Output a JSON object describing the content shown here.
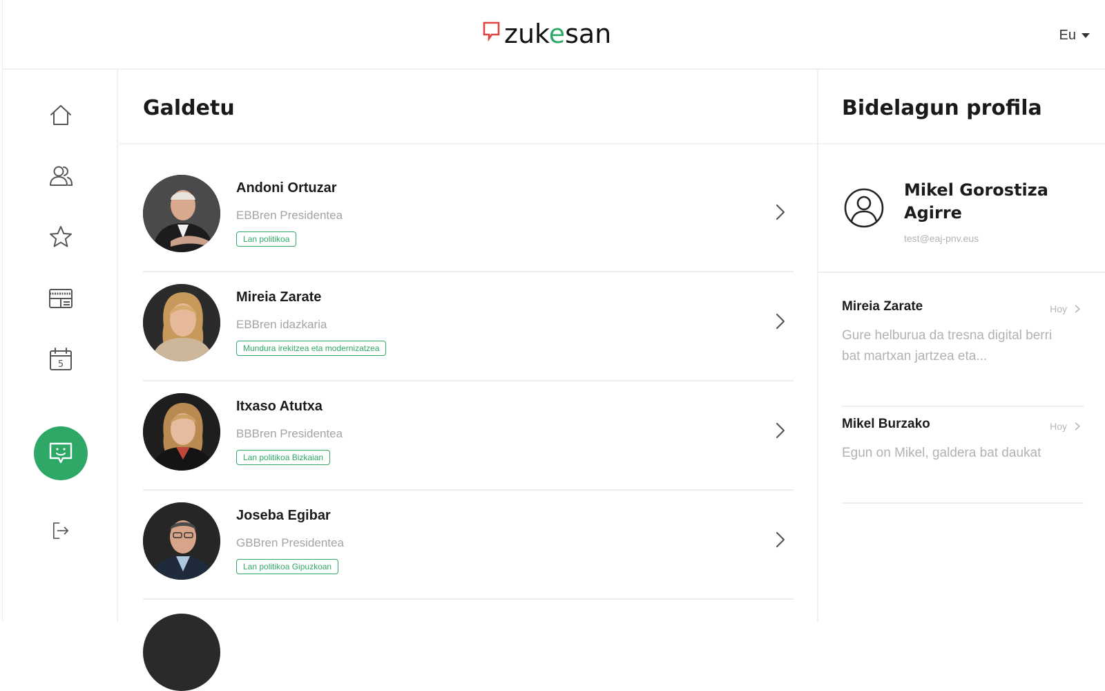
{
  "header": {
    "logo_text_a": "zuk",
    "logo_text_b": "e",
    "logo_text_c": "san",
    "language": "Eu"
  },
  "colors": {
    "accent": "#2ea866",
    "logo_mark": "#e0443f"
  },
  "sidebar": {
    "items": [
      {
        "icon": "home-icon"
      },
      {
        "icon": "users-icon"
      },
      {
        "icon": "star-icon"
      },
      {
        "icon": "news-icon"
      },
      {
        "icon": "calendar-icon"
      },
      {
        "icon": "chat-icon",
        "active": true
      },
      {
        "icon": "logout-icon"
      }
    ]
  },
  "main": {
    "title": "Galdetu",
    "people": [
      {
        "name": "Andoni Ortuzar",
        "role": "EBBren Presidentea",
        "tag": "Lan politikoa"
      },
      {
        "name": "Mireia Zarate",
        "role": "EBBren idazkaria",
        "tag": "Mundura irekitzea eta modernizatzea"
      },
      {
        "name": "Itxaso Atutxa",
        "role": "BBBren Presidentea",
        "tag": "Lan politikoa Bizkaian"
      },
      {
        "name": "Joseba Egibar",
        "role": "GBBren Presidentea",
        "tag": "Lan politikoa Gipuzkoan"
      }
    ]
  },
  "right": {
    "title": "Bidelagun profila",
    "profile": {
      "name": "Mikel Gorostiza Agirre",
      "email": "test@eaj-pnv.eus"
    },
    "messages": [
      {
        "name": "Mireia Zarate",
        "time": "Hoy",
        "text": "Gure helburua da tresna digital berri bat martxan jartzea eta..."
      },
      {
        "name": "Mikel Burzako",
        "time": "Hoy",
        "text": "Egun on Mikel, galdera bat daukat"
      }
    ]
  }
}
